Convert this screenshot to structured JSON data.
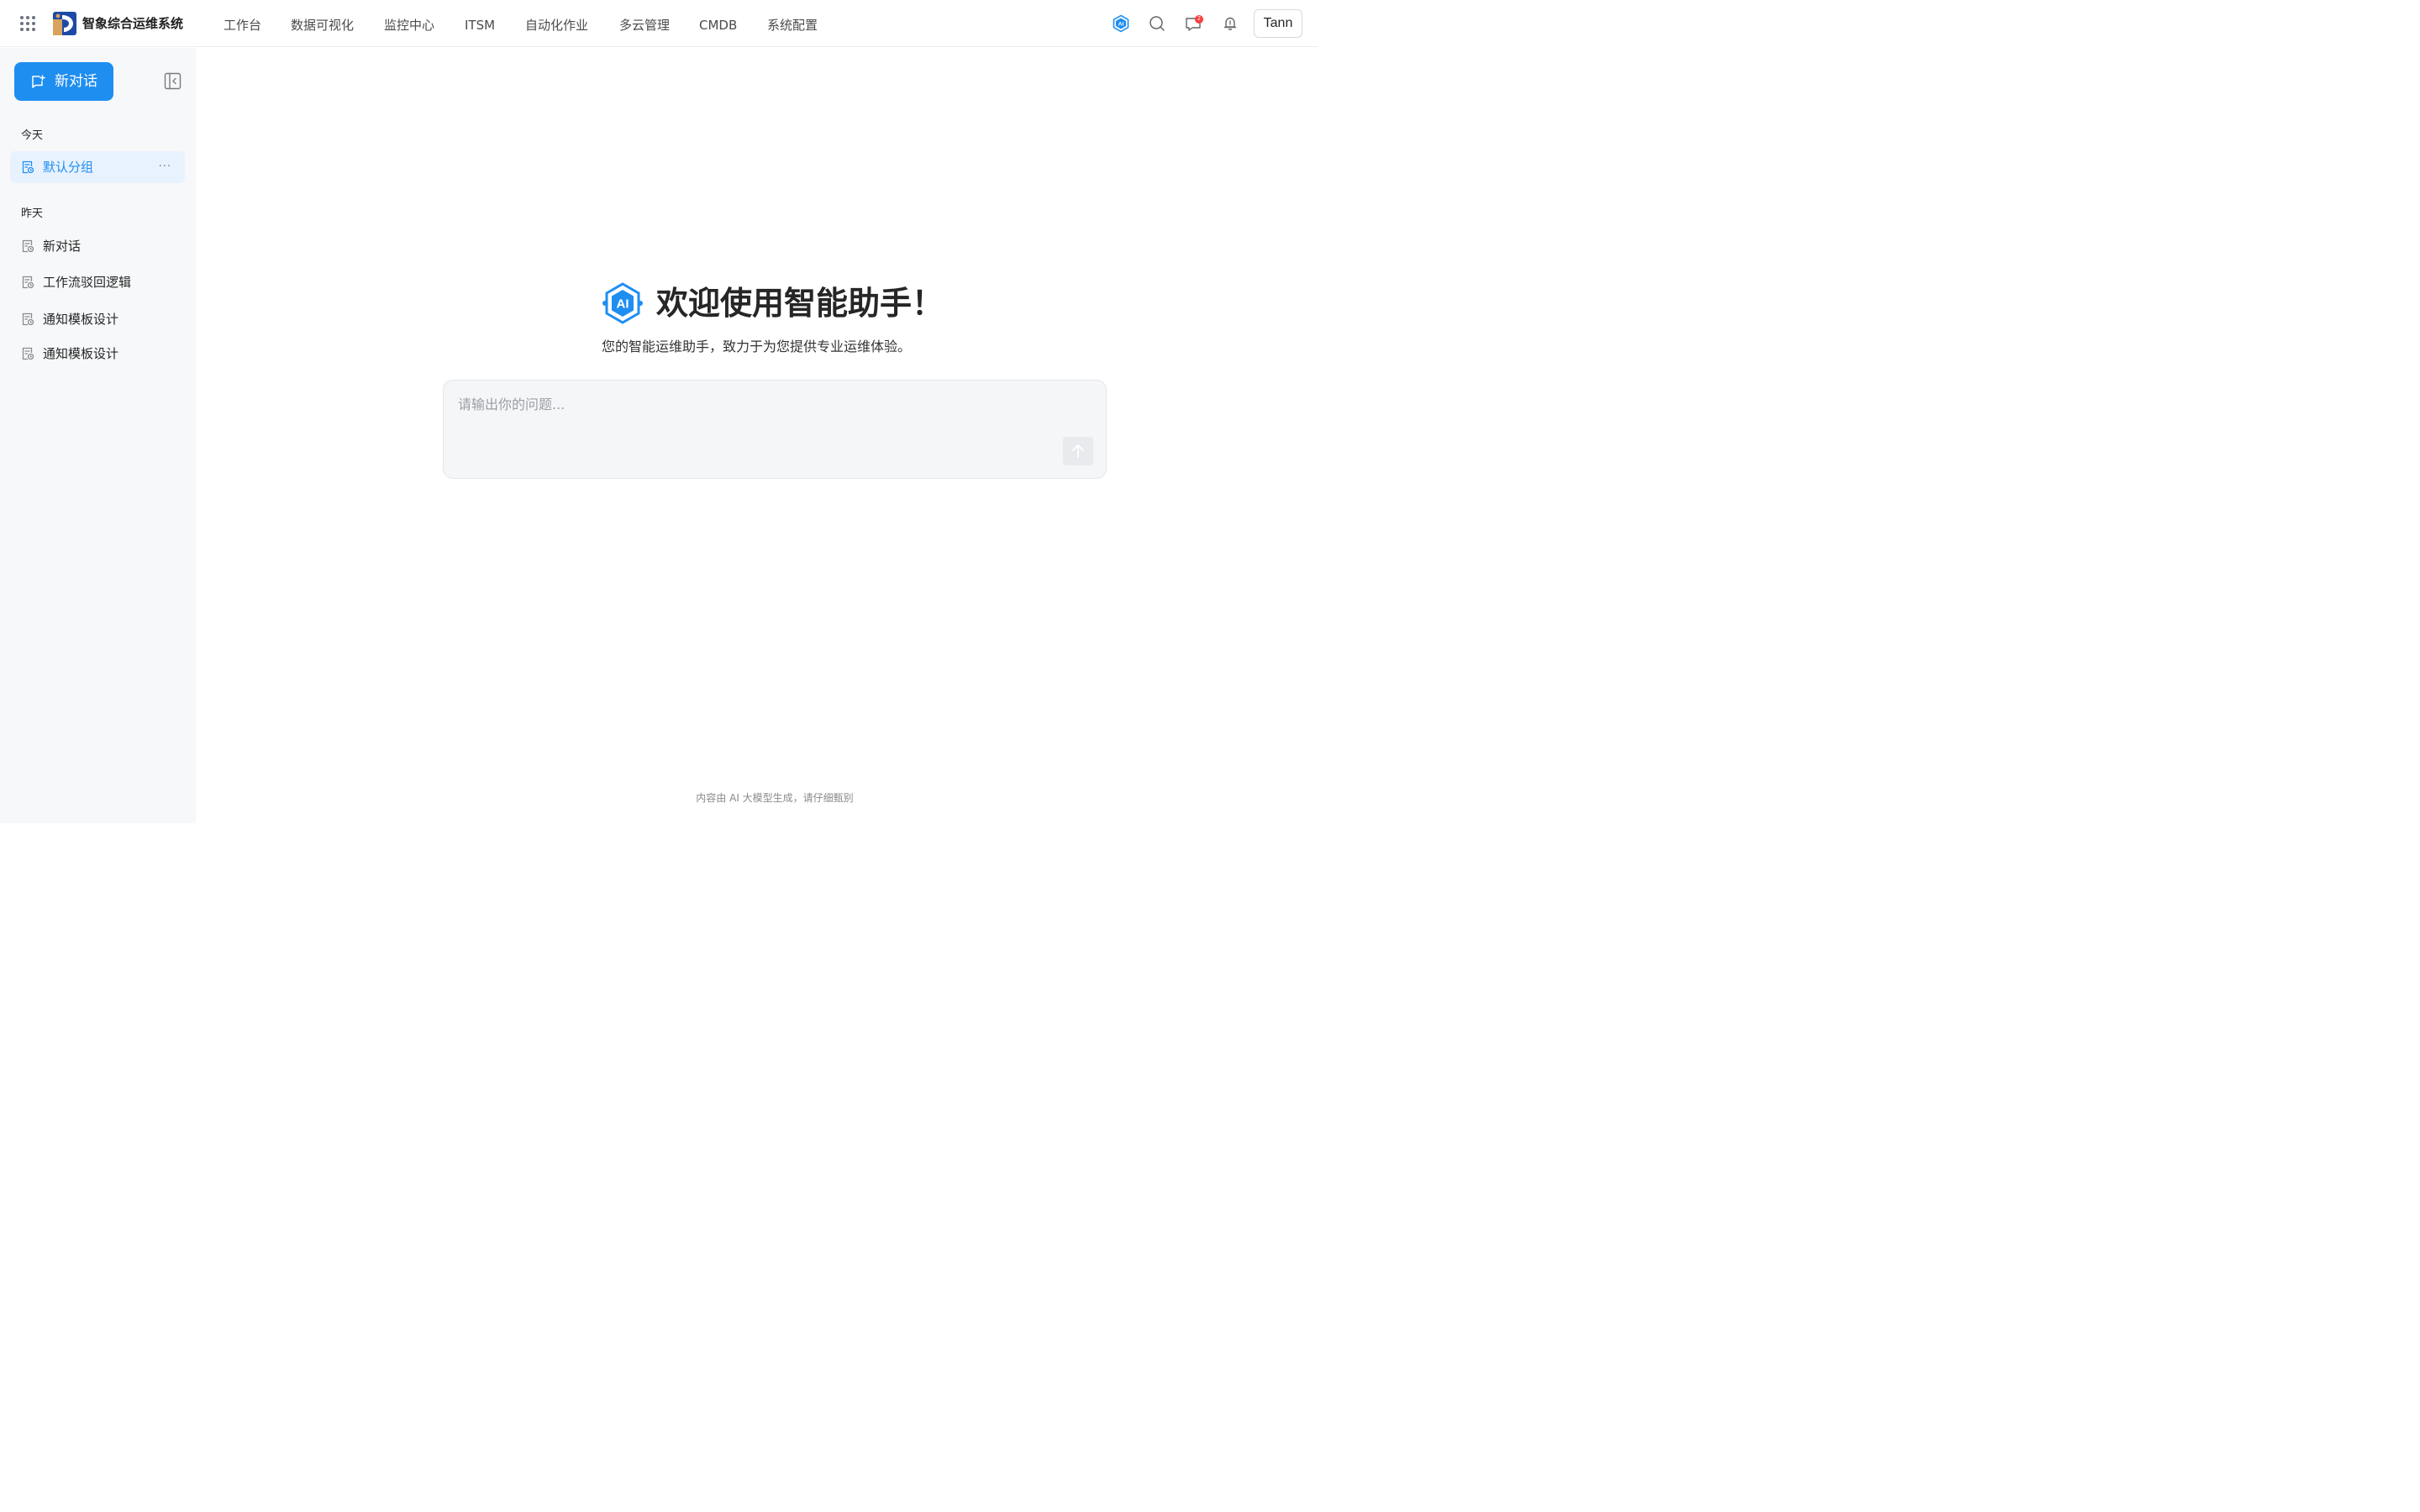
{
  "header": {
    "brand_name": "智象综合运维系统",
    "nav": [
      "工作台",
      "数据可视化",
      "监控中心",
      "ITSM",
      "自动化作业",
      "多云管理",
      "CMDB",
      "系统配置"
    ],
    "notification_count": "2",
    "user_name": "Tann",
    "icons": [
      "apps-grid-icon",
      "ai-assistant-icon",
      "search-icon",
      "message-icon",
      "bell-icon"
    ]
  },
  "sidebar": {
    "new_chat_label": "新对话",
    "groups": [
      {
        "label": "今天",
        "items": [
          {
            "label": "默认分组",
            "more": "···"
          }
        ]
      },
      {
        "label": "昨天",
        "items": [
          {
            "label": "新对话"
          },
          {
            "label": "工作流驳回逻辑"
          },
          {
            "label": "通知模板设计"
          },
          {
            "label": "通知模板设计"
          }
        ]
      }
    ]
  },
  "main": {
    "welcome_title": "欢迎使用智能助手！",
    "welcome_subtitle": "您的智能运维助手，致力于为您提供专业运维体验。",
    "input_placeholder": "请输出你的问题...",
    "footer_note": "内容由 AI 大模型生成，请仔细甄别"
  },
  "colors": {
    "accent": "#1f8ef1",
    "sidebar_bg": "#f7f8fa",
    "active_item_bg": "#e8f2fe",
    "badge": "#f53f3f"
  }
}
